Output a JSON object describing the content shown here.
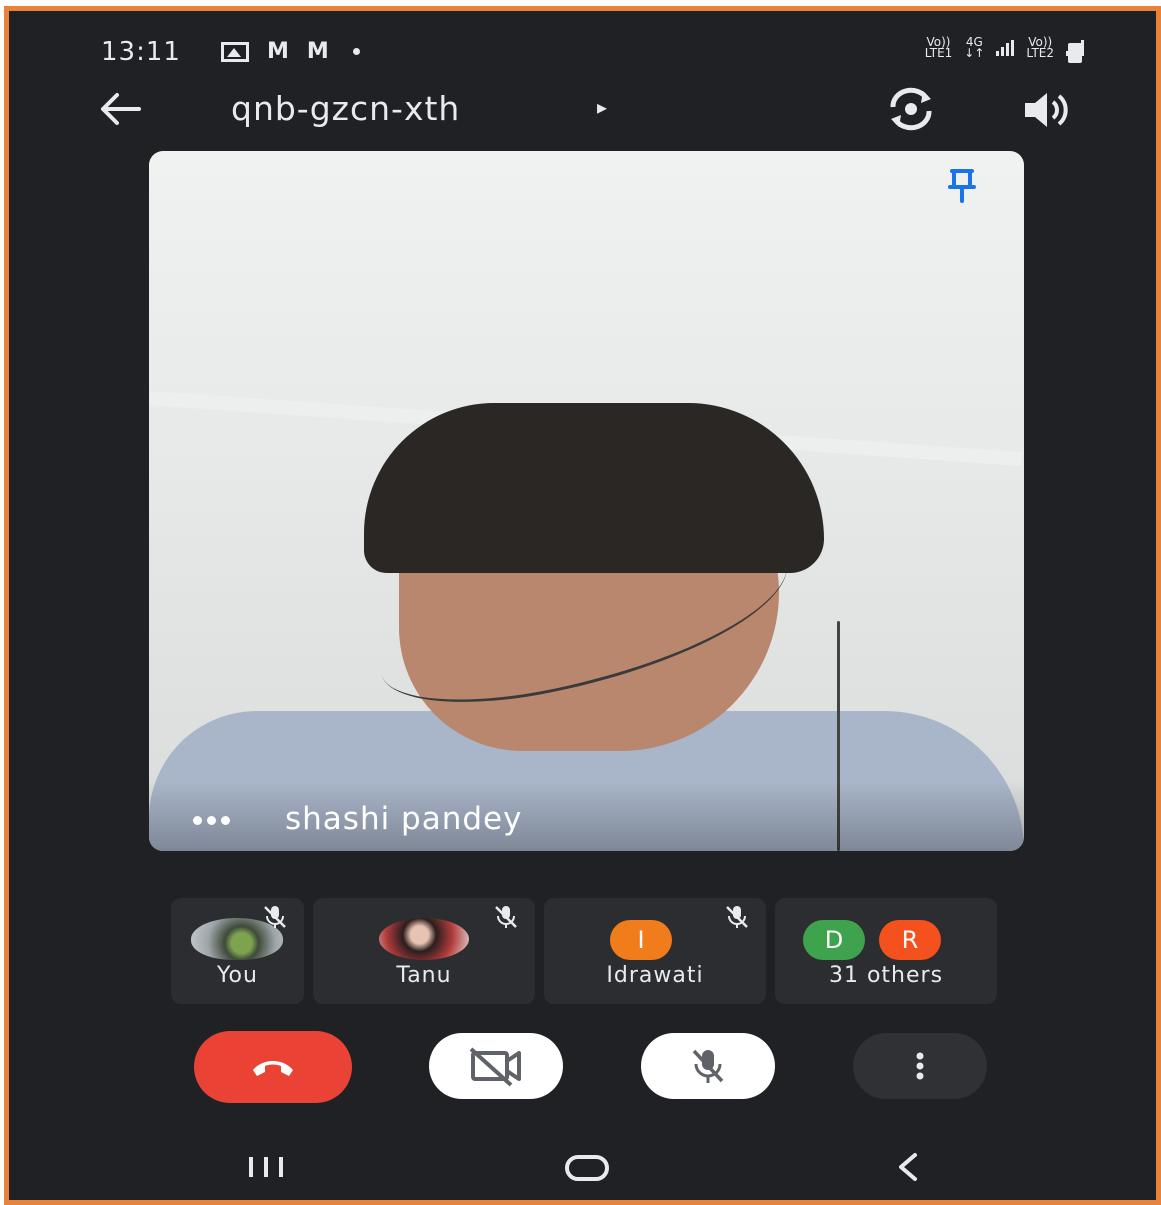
{
  "status_bar": {
    "time": "13:11",
    "net1_top": "Vo))",
    "net1_bottom": "LTE1",
    "net_type_top": "4G",
    "net_type_bottom": "↓↑",
    "net2_top": "Vo))",
    "net2_bottom": "LTE2",
    "icons": [
      "gallery-icon",
      "gmail-icon",
      "gmail-icon",
      "dot-icon",
      "signal-icon",
      "battery-icon"
    ]
  },
  "app_bar": {
    "meeting_code": "qnb-gzcn-xth",
    "caret": "▸",
    "icons": [
      "back-arrow-icon",
      "switch-camera-icon",
      "speaker-icon"
    ]
  },
  "main_video": {
    "participant_name": "shashi pandey",
    "icons": [
      "pin-icon",
      "speaking-dots-icon"
    ]
  },
  "participants": [
    {
      "name": "You",
      "avatar": "photo",
      "muted": true
    },
    {
      "name": "Tanu",
      "avatar": "photo",
      "muted": true
    },
    {
      "name": "Idrawati",
      "avatar_letter": "I",
      "avatar_color": "#f07c1b",
      "muted": true
    },
    {
      "name": "31 others",
      "avatar_letters": [
        "D",
        "R"
      ],
      "avatar_colors": [
        "#3fa34d",
        "#f4511e"
      ]
    }
  ],
  "controls": {
    "end_call_color": "#ea4335",
    "icons": [
      "end-call-icon",
      "camera-off-icon",
      "mic-off-icon",
      "more-options-icon"
    ]
  },
  "nav_bar": {
    "icons": [
      "recents-icon",
      "home-icon",
      "back-icon"
    ]
  },
  "colors": {
    "frame_border": "#e9833a",
    "background": "#202124",
    "tile_background": "#2c2d30",
    "pin_blue": "#1a73e8"
  }
}
